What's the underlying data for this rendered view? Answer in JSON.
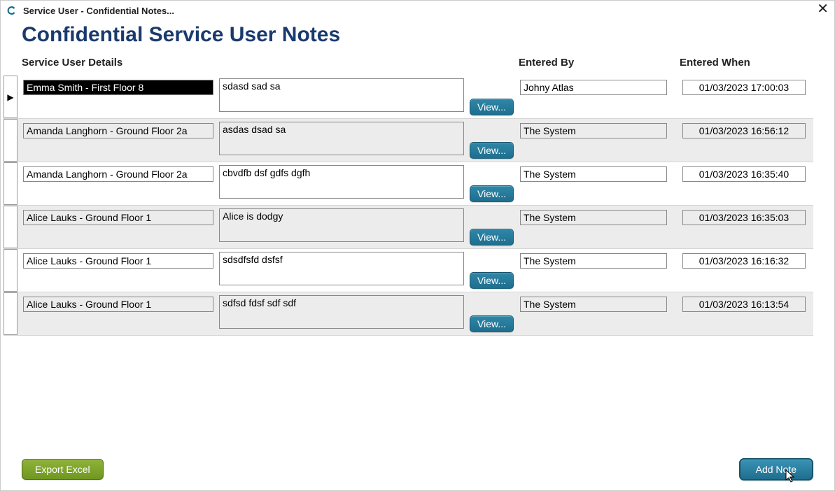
{
  "window": {
    "title": "Service User - Confidential Notes..."
  },
  "page": {
    "heading": "Confidential Service User Notes"
  },
  "columns": {
    "service_user": "Service User Details",
    "entered_by": "Entered By",
    "entered_when": "Entered When"
  },
  "rows": [
    {
      "selected": true,
      "service_user": "Emma Smith - First Floor 8",
      "note": "sdasd sad sa",
      "entered_by": "Johny Atlas",
      "entered_when": "01/03/2023 17:00:03"
    },
    {
      "selected": false,
      "service_user": "Amanda Langhorn - Ground Floor 2a",
      "note": "asdas dsad sa",
      "entered_by": "The System",
      "entered_when": "01/03/2023 16:56:12"
    },
    {
      "selected": false,
      "service_user": "Amanda Langhorn - Ground Floor 2a",
      "note": "cbvdfb dsf gdfs dgfh",
      "entered_by": "The System",
      "entered_when": "01/03/2023 16:35:40"
    },
    {
      "selected": false,
      "service_user": "Alice Lauks - Ground Floor 1",
      "note": "Alice is dodgy",
      "entered_by": "The System",
      "entered_when": "01/03/2023 16:35:03"
    },
    {
      "selected": false,
      "service_user": "Alice Lauks - Ground Floor 1",
      "note": "sdsdfsfd dsfsf",
      "entered_by": "The System",
      "entered_when": "01/03/2023 16:16:32"
    },
    {
      "selected": false,
      "service_user": "Alice Lauks - Ground Floor 1",
      "note": "sdfsd fdsf sdf sdf",
      "entered_by": "The System",
      "entered_when": "01/03/2023 16:13:54"
    }
  ],
  "buttons": {
    "view": "View...",
    "export": "Export Excel",
    "add": "Add Note"
  }
}
